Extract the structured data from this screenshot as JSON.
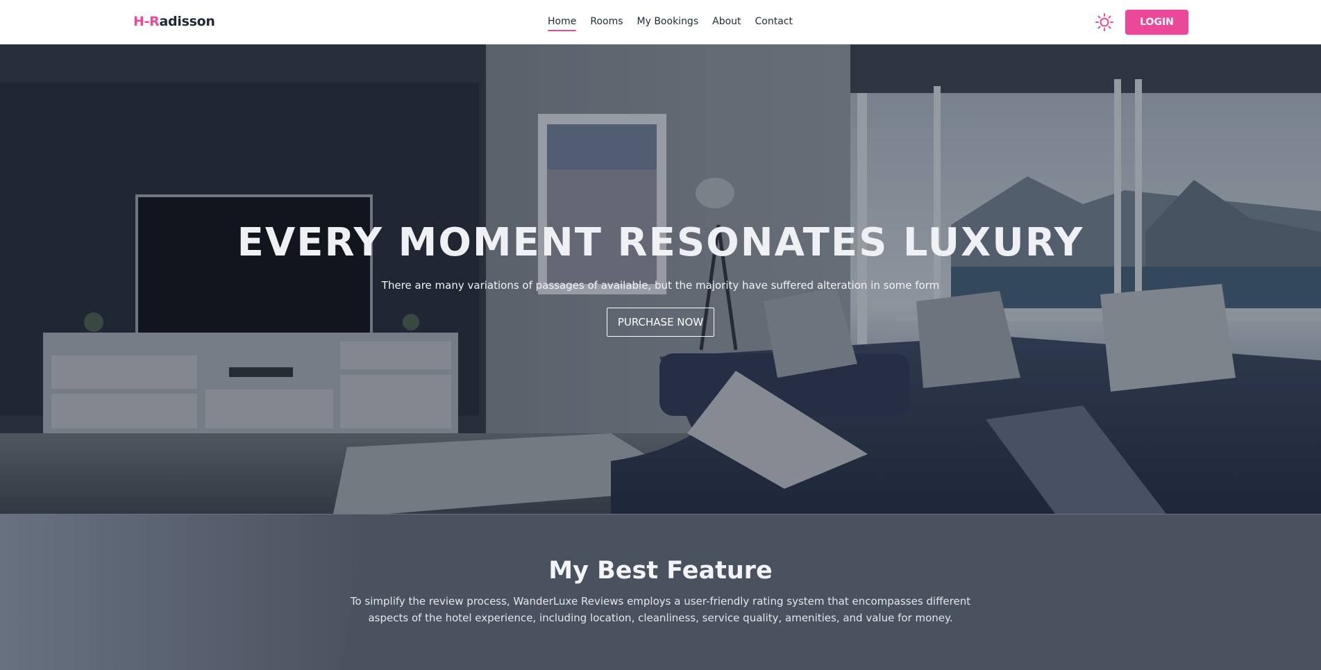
{
  "navbar": {
    "logo_prefix": "H-R",
    "logo_suffix": "adisson",
    "links": [
      {
        "label": "Home",
        "active": true
      },
      {
        "label": "Rooms",
        "active": false
      },
      {
        "label": "My Bookings",
        "active": false
      },
      {
        "label": "About",
        "active": false
      },
      {
        "label": "Contact",
        "active": false
      }
    ],
    "theme_icon": "sun-icon",
    "login_label": "LOGIN"
  },
  "hero": {
    "title": "EVERY MOMENT RESONATES LUXURY",
    "subtitle": "There are many variations of passages of available, but the majority have suffered alteration in some form",
    "cta_label": "PURCHASE NOW"
  },
  "feature": {
    "title": "My Best Feature",
    "description": "To simplify the review process, WanderLuxe Reviews employs a user-friendly rating system that encompasses different aspects of the hotel experience, including location, cleanliness, service quality, amenities, and value for money."
  },
  "colors": {
    "accent": "#ec4899",
    "text_dark": "#1f2937",
    "section_bg": "#4b5563"
  }
}
